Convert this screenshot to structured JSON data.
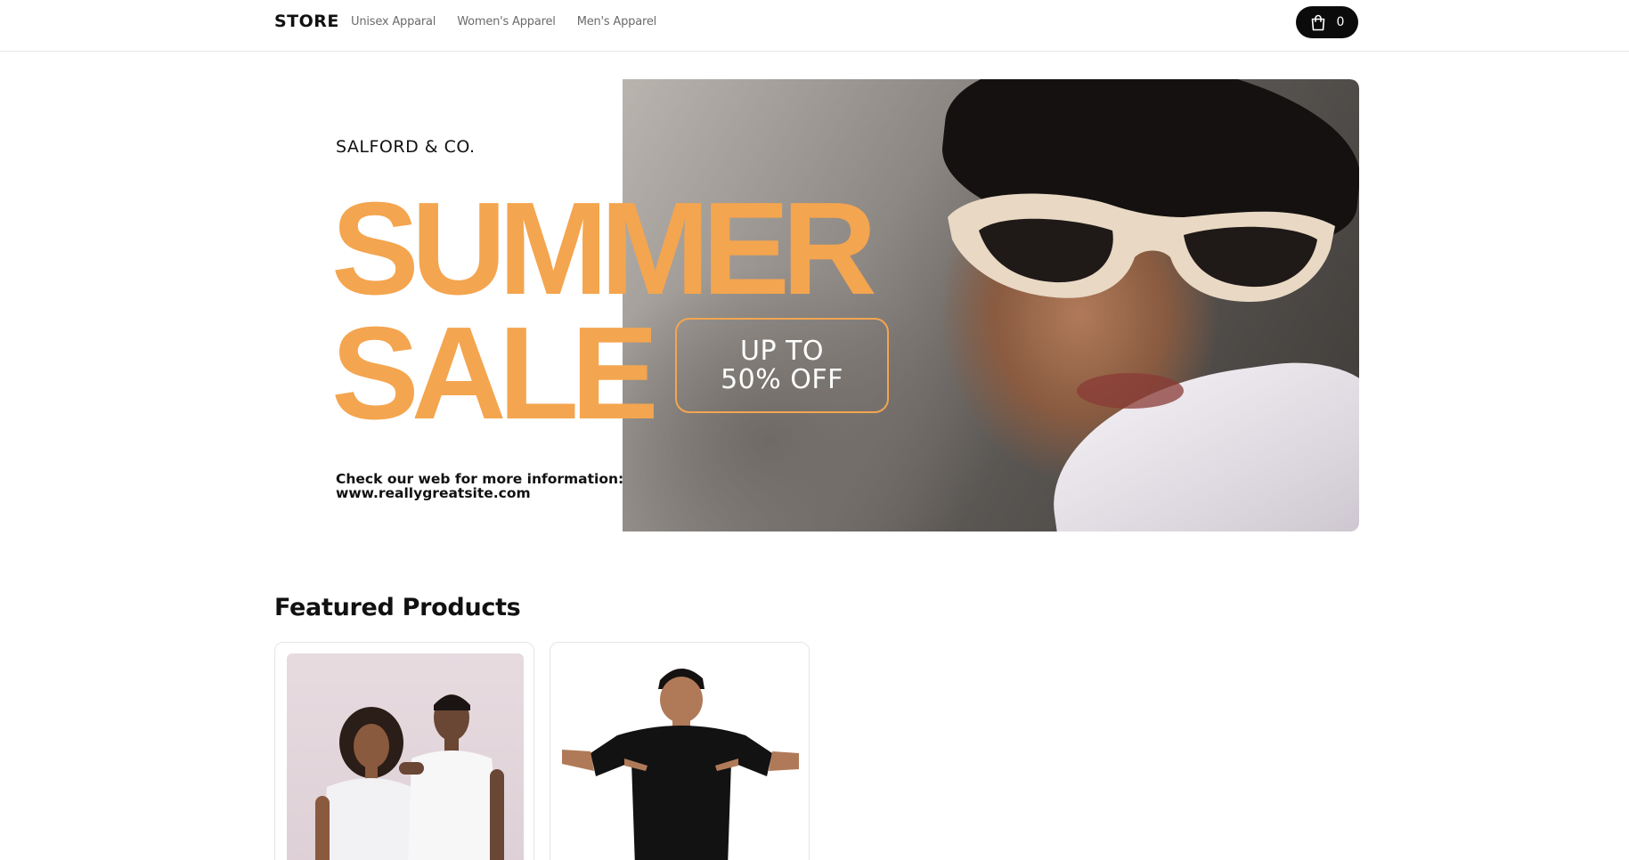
{
  "header": {
    "brand": "STORE",
    "nav": [
      {
        "label": "Unisex Apparal"
      },
      {
        "label": "Women's Apparel"
      },
      {
        "label": "Men's Apparel"
      }
    ],
    "cart": {
      "icon": "shopping-bag-icon",
      "count": "0"
    }
  },
  "hero": {
    "brand": "SALFORD & CO.",
    "headline_line1": "SUMMER",
    "headline_line2": "SALE",
    "offer_line1": "UP TO",
    "offer_line2": "50% OFF",
    "info_line1": "Check our web for more information:",
    "info_line2": "www.reallygreatsite.com",
    "accent_color": "#f4a54f"
  },
  "featured": {
    "title": "Featured Products"
  },
  "colors": {
    "accent": "#f4a54f",
    "cart_bg": "#0b0b0b",
    "nav_text": "#6b6b6b"
  }
}
